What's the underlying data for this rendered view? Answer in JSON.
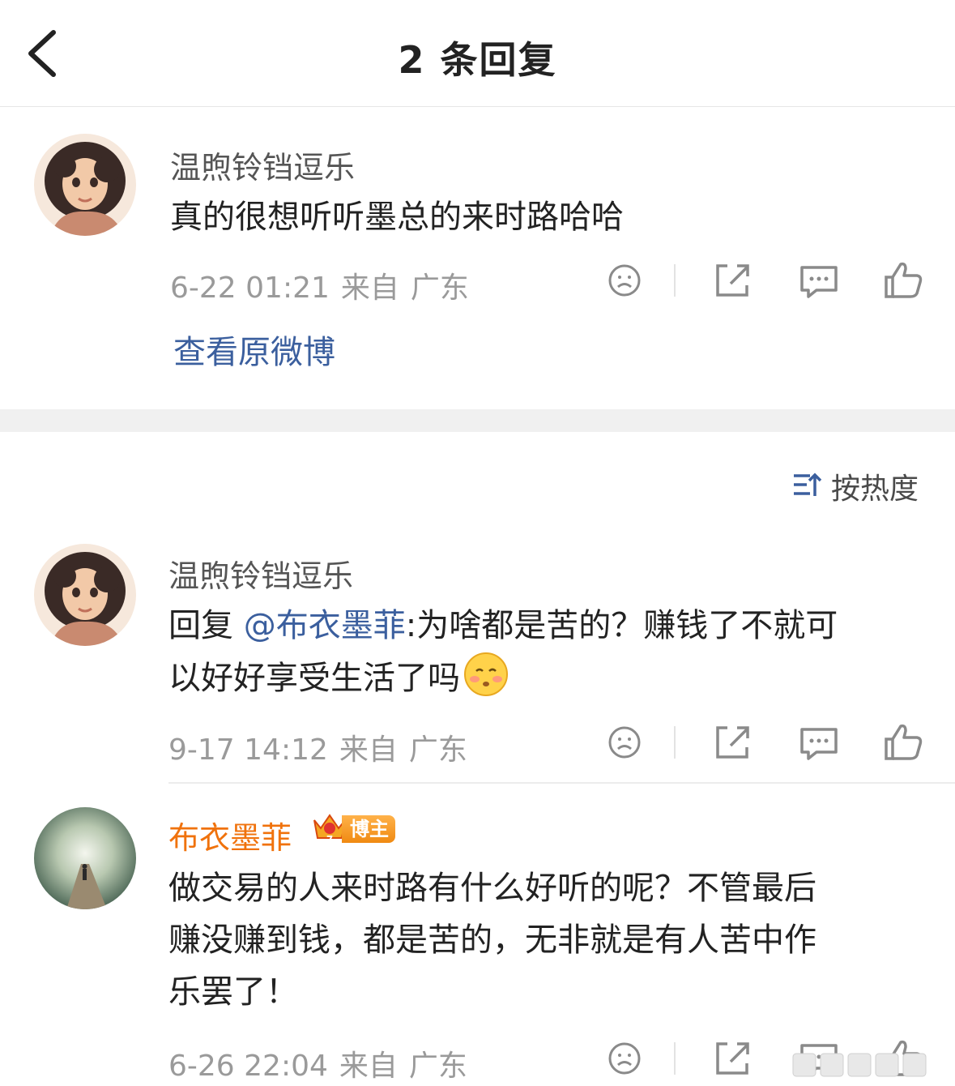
{
  "header": {
    "title": "2 条回复"
  },
  "root_comment": {
    "username": "温煦铃铛逗乐",
    "text": "真的很想听听墨总的来时路哈哈",
    "time": "6-22 01:21",
    "from": "来自",
    "location": "广东",
    "view_original": "查看原微博"
  },
  "sort": {
    "label": "按热度"
  },
  "replies": [
    {
      "username": "温煦铃铛逗乐",
      "reply_prefix": "回复 ",
      "mention": "@布衣墨菲",
      "text_line1": ":为啥都是苦的？赚钱了不就可",
      "text_line2": "以好好享受生活了吗",
      "time": "9-17 14:12",
      "from": "来自",
      "location": "广东"
    },
    {
      "username": "布衣墨菲",
      "badge": "博主",
      "badge_level": "7",
      "text_line1": "做交易的人来时路有什么好听的呢？不管最后",
      "text_line2": "赚没赚到钱，都是苦的，无非就是有人苦中作",
      "text_line3": "乐罢了！",
      "time": "6-26 22:04",
      "from": "来自",
      "location": "广东"
    }
  ],
  "icons": [
    "back-arrow-icon",
    "dislike-face-icon",
    "share-icon",
    "comment-icon",
    "like-thumb-icon",
    "sort-icon",
    "blush-emoji-icon",
    "crown-badge-icon"
  ],
  "colors": {
    "link": "#3b5f9e",
    "blogger_name": "#f0720c",
    "meta": "#9a9a9a",
    "separator": "#f0f0f0"
  }
}
